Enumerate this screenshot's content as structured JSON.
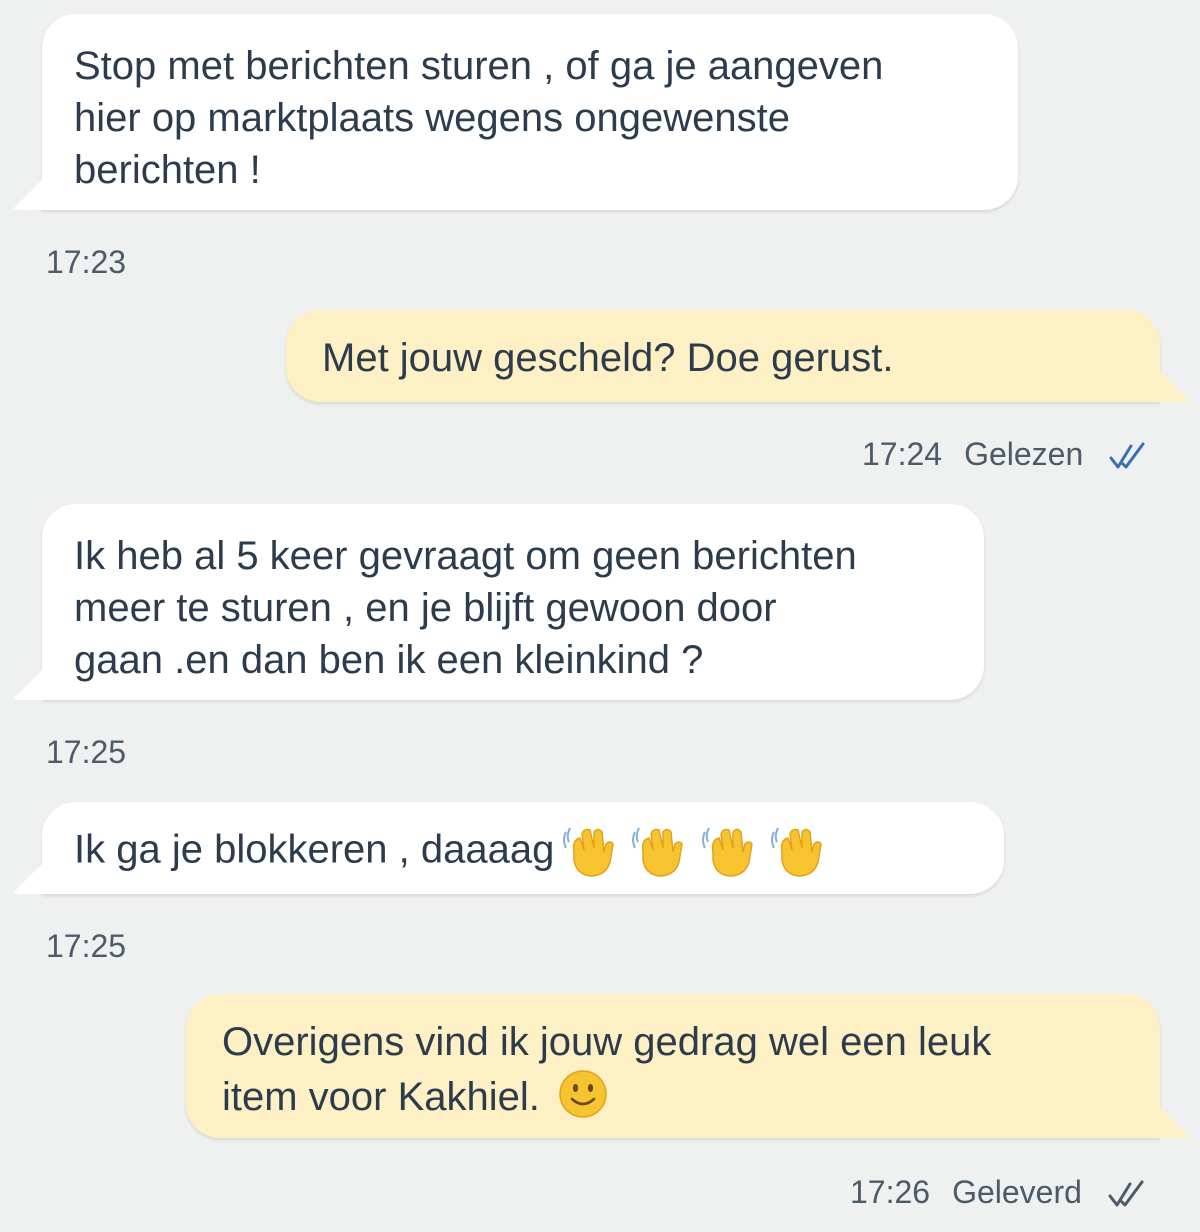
{
  "messages": [
    {
      "direction": "incoming",
      "text": "Stop met berichten sturen , of ga je aangeven\nhier op marktplaats wegens ongewenste\nberichten !",
      "time": "17:23"
    },
    {
      "direction": "outgoing",
      "text": "Met jouw gescheld? Doe gerust.",
      "time": "17:24",
      "status": "Gelezen",
      "status_icon": "double-check-icon"
    },
    {
      "direction": "incoming",
      "text": "Ik heb al 5 keer gevraagt om geen berichten\nmeer te sturen , en je blijft gewoon door\ngaan .en dan ben ik een kleinkind ?",
      "time": "17:25"
    },
    {
      "direction": "incoming",
      "text": "Ik ga je blokkeren , daaaag",
      "emoji": "waving-hand-icon x4",
      "time": "17:25"
    },
    {
      "direction": "outgoing",
      "text": "Overigens vind ik jouw gedrag wel een leuk\nitem voor Kakhiel.",
      "emoji": "slightly-smiling-face-icon",
      "time": "17:26",
      "status": "Geleverd",
      "status_icon": "double-check-icon"
    }
  ],
  "colors": {
    "background": "#eff0f0",
    "incoming_bubble": "#ffffff",
    "outgoing_bubble": "#fdf0c4",
    "text": "#2d3c4d",
    "meta_text": "#4d5a68",
    "check_color": "#3a6fb0"
  }
}
